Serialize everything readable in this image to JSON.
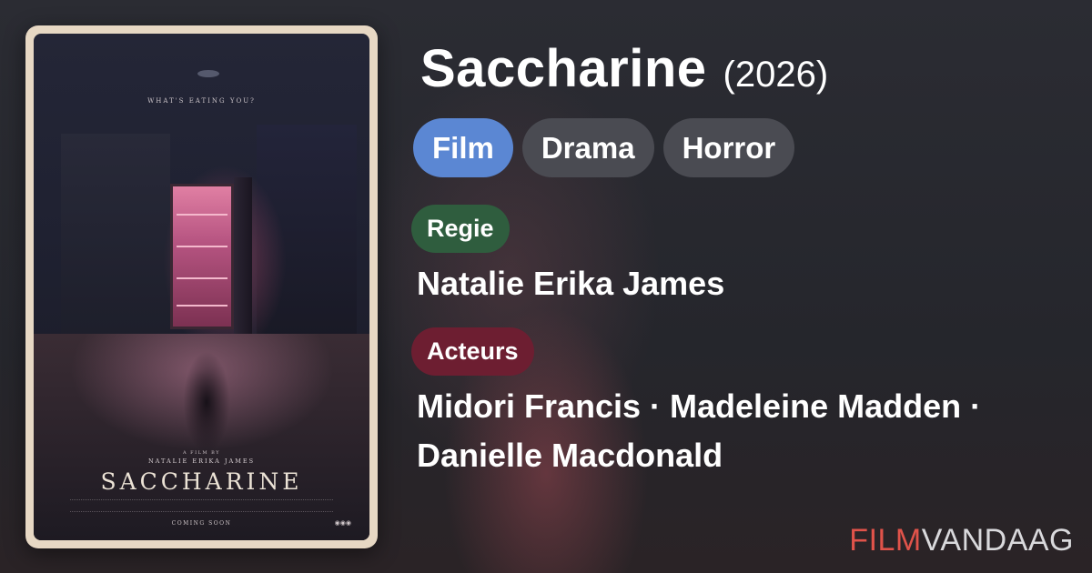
{
  "movie": {
    "title": "Saccharine",
    "year": "(2026)"
  },
  "genres": [
    {
      "label": "Film",
      "primary": true
    },
    {
      "label": "Drama",
      "primary": false
    },
    {
      "label": "Horror",
      "primary": false
    }
  ],
  "director": {
    "label": "Regie",
    "name": "Natalie Erika James"
  },
  "cast": {
    "label": "Acteurs",
    "line1": "Midori Francis · Madeleine Madden ·",
    "line2": "Danielle Macdonald"
  },
  "poster": {
    "tagline": "WHAT'S EATING YOU?",
    "credit_prefix": "A FILM BY",
    "credit_name": "NATALIE ERIKA JAMES",
    "title": "SACCHARINE",
    "coming_soon": "COMING SOON",
    "ratings": "◉◉◉"
  },
  "brand": {
    "part1": "FILM",
    "part2": "VANDAAG"
  },
  "colors": {
    "background": "#25272d",
    "chip_primary": "#5b87d3",
    "chip_default": "#4a4b52",
    "director_badge": "#2f5d3e",
    "actors_badge": "#6d1e31",
    "brand_red": "#e0534a"
  }
}
